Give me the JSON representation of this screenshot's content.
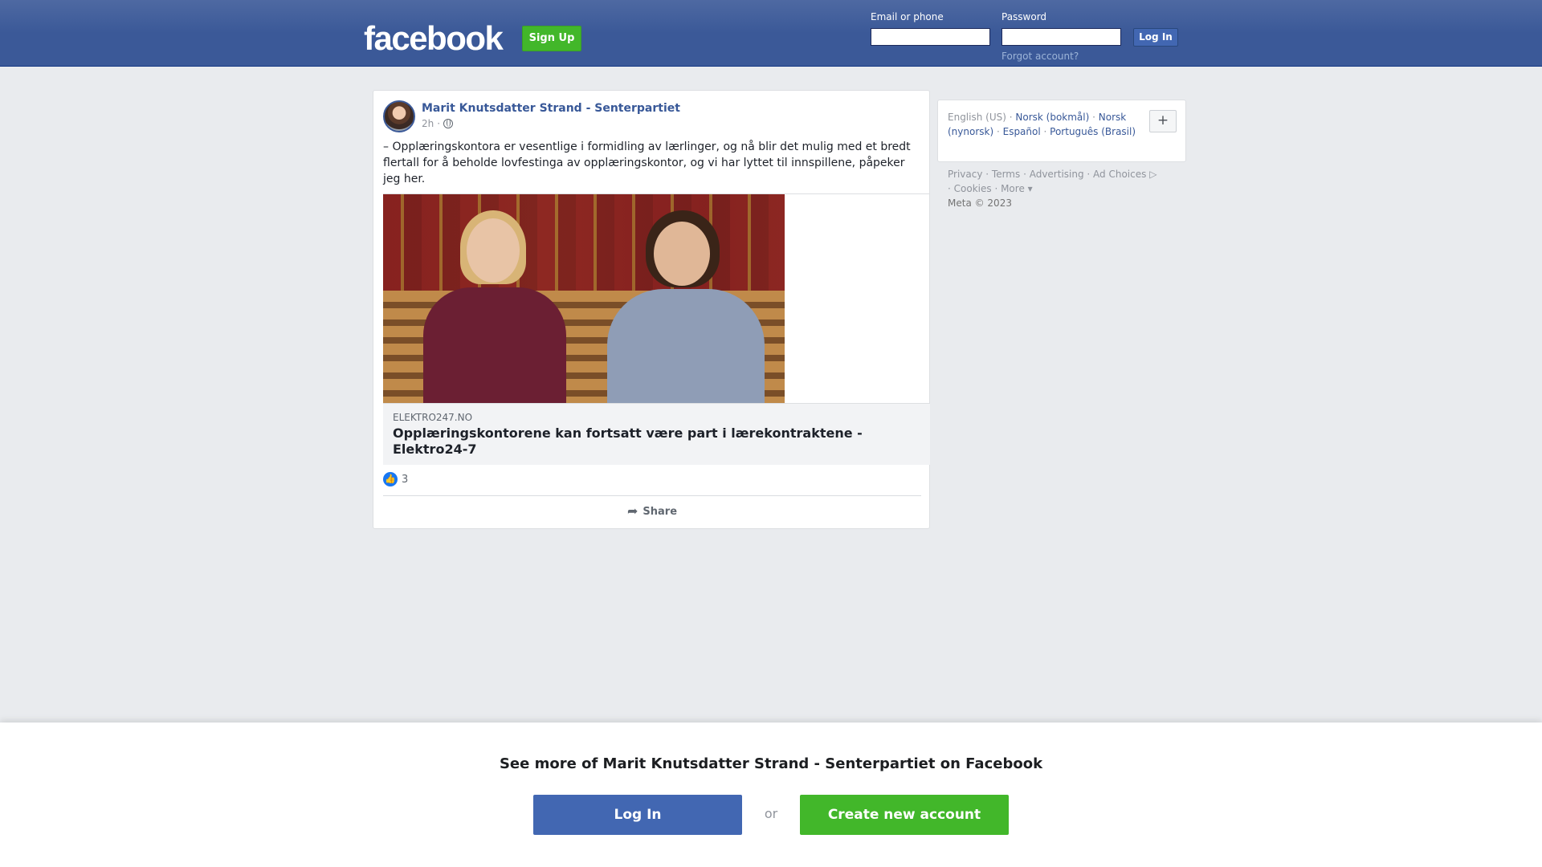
{
  "header": {
    "logo": "facebook",
    "signup_label": "Sign Up",
    "email_label": "Email or phone",
    "password_label": "Password",
    "login_label": "Log In",
    "forgot_label": "Forgot account?"
  },
  "post": {
    "author": "Marit Knutsdatter Strand - Senterpartiet",
    "time": "2h",
    "separator": "·",
    "text": "– Opplæringskontora er vesentlige i formidling av lærlinger, og nå blir det mulig med et bredt flertall for å beholde lovfestinga av opplæringskontor, og vi har lyttet til innspillene, påpeker jeg her.",
    "link": {
      "domain": "ELEKTRO247.NO",
      "title": "Opplæringskontorene kan fortsatt være part i lærekontraktene - Elektro24-7"
    },
    "reaction_count": "3",
    "share_label": "Share"
  },
  "sidebar": {
    "languages": {
      "current": "English (US)",
      "options": [
        "Norsk (bokmål)",
        "Norsk (nynorsk)",
        "Español",
        "Português (Brasil)"
      ],
      "more_label": "+"
    },
    "footer_links": [
      "Privacy",
      "Terms",
      "Advertising",
      "Ad Choices",
      "Cookies",
      "More"
    ],
    "copyright": "Meta © 2023"
  },
  "banner": {
    "title": "See more of Marit Knutsdatter Strand - Senterpartiet on Facebook",
    "login_label": "Log In",
    "or_label": "or",
    "create_label": "Create new account"
  },
  "colors": {
    "brand_blue": "#3b5998",
    "button_green": "#42b72a",
    "link_blue": "#385898",
    "background": "#e9ebee"
  }
}
